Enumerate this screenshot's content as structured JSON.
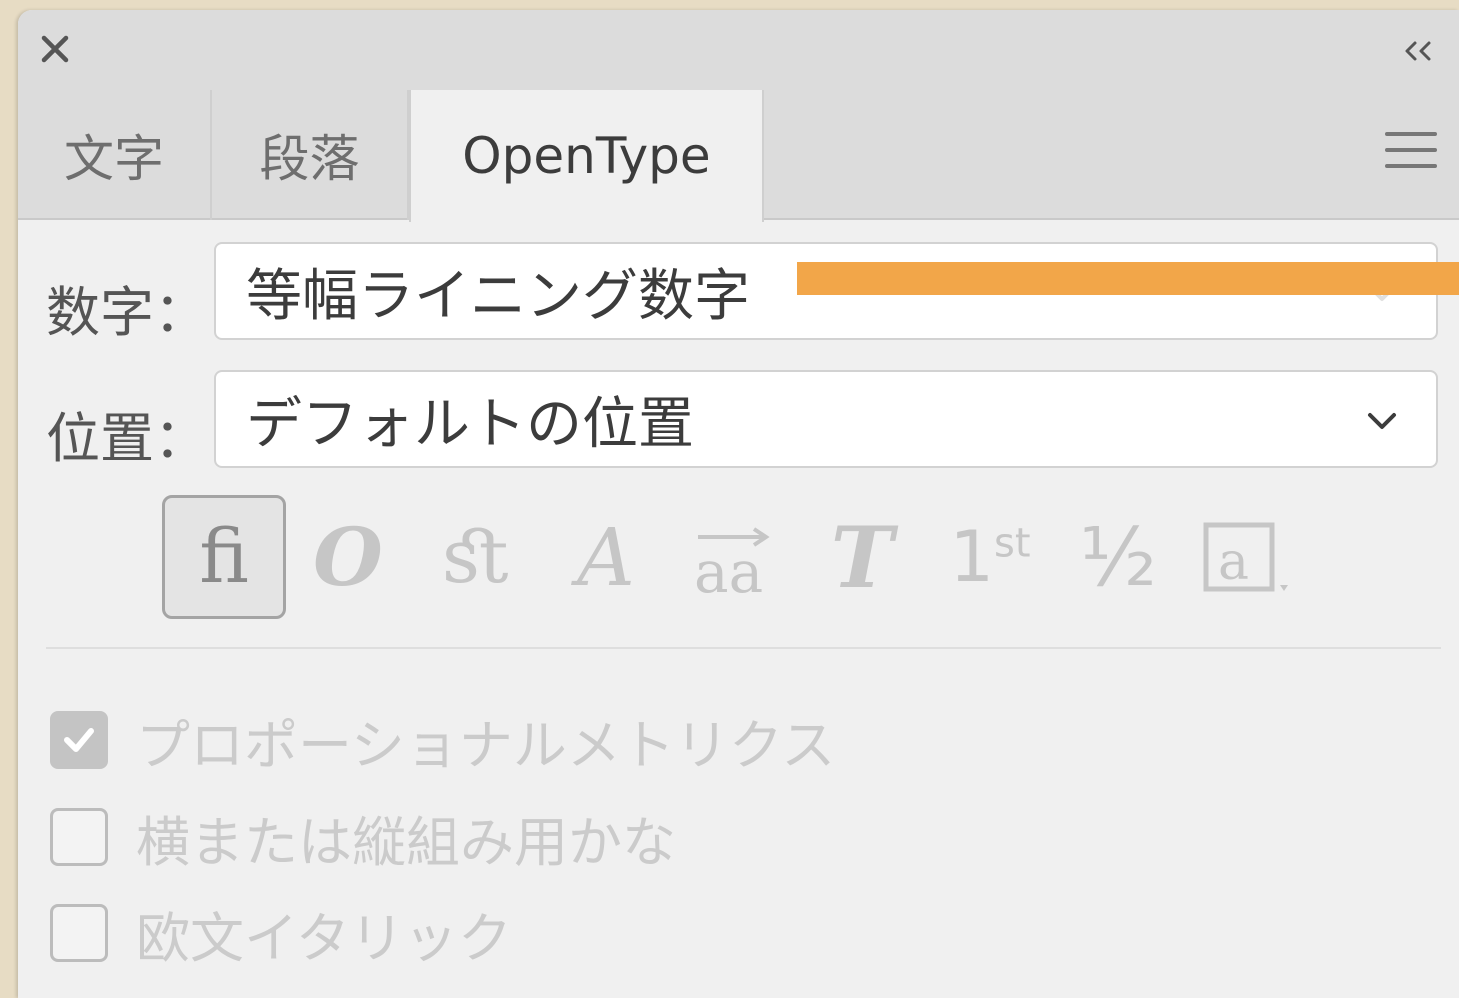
{
  "panel": {
    "close_icon": "close-icon",
    "collapse_label": "‹‹",
    "menu_icon": "hamburger-menu-icon"
  },
  "tabs": [
    {
      "label": "文字",
      "active": false
    },
    {
      "label": "段落",
      "active": false
    },
    {
      "label": "OpenType",
      "active": true
    }
  ],
  "numbers": {
    "label": "数字：",
    "value": "等幅ライニング数字"
  },
  "position": {
    "label": "位置：",
    "value": "デフォルトの位置"
  },
  "glyph_buttons": [
    {
      "icon": "ligature-fi-icon",
      "text": "ﬁ",
      "active": true
    },
    {
      "icon": "swash-icon",
      "text": "𝒪",
      "active": false
    },
    {
      "icon": "discretionary-ligature-icon",
      "text": "ﬆ",
      "active": false
    },
    {
      "icon": "stylistic-alternates-icon",
      "text": "𝒜",
      "active": false
    },
    {
      "icon": "contextual-alternates-icon",
      "text": "aa",
      "active": false
    },
    {
      "icon": "titling-alternates-icon",
      "text": "T",
      "active": false
    },
    {
      "icon": "ordinals-icon",
      "text": "1st",
      "active": false
    },
    {
      "icon": "fractions-icon",
      "text": "½",
      "active": false
    },
    {
      "icon": "stylistic-sets-icon",
      "text": "a",
      "active": false
    }
  ],
  "checkboxes": [
    {
      "label": "プロポーショナルメトリクス",
      "checked": true
    },
    {
      "label": "横または縦組み用かな",
      "checked": false
    },
    {
      "label": "欧文イタリック",
      "checked": false
    }
  ],
  "colors": {
    "highlight": "#f2a649",
    "panel_bg": "#f0f0f0",
    "tabbar_bg": "#dcdcdc"
  }
}
